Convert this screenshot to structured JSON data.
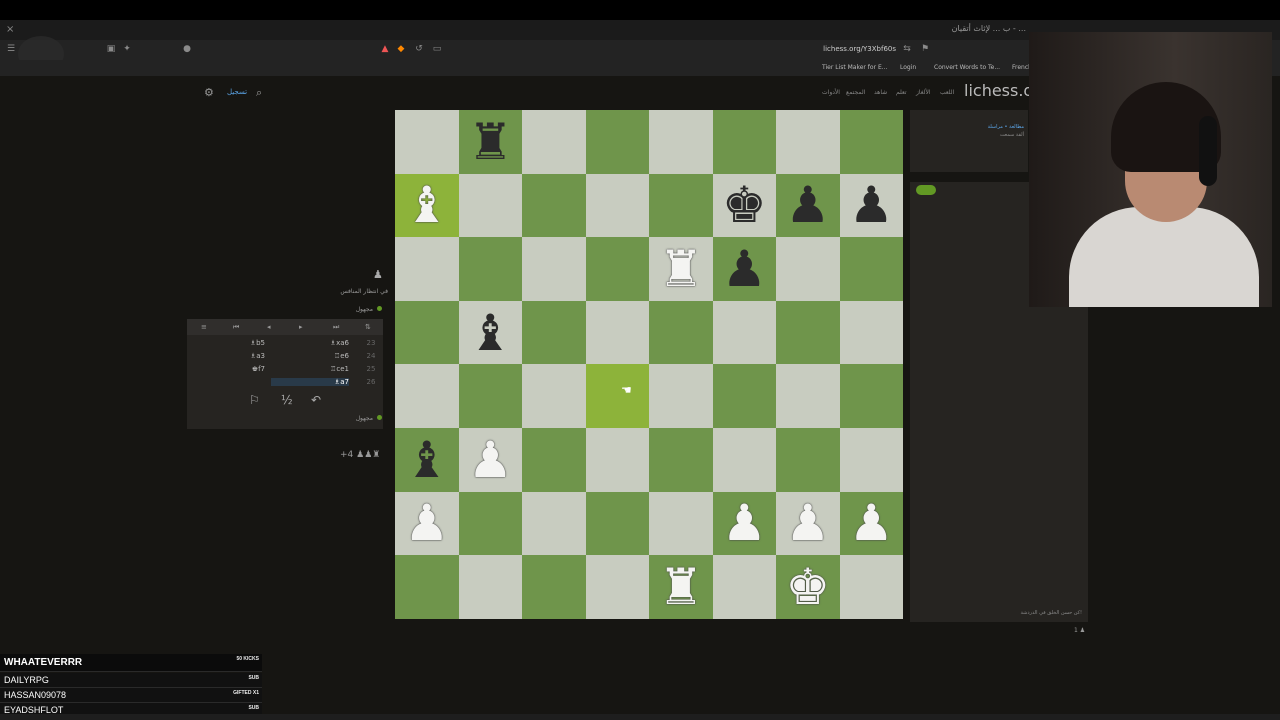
{
  "browser": {
    "tab_close": "×",
    "tab_title_right": "ب ... لإثاث أتقيان - ...",
    "url": "lichess.org/Y3Xbf60s",
    "bookmarks": [
      "Tier List Maker for E...",
      "Login",
      "Convert Words to Te...",
      "French"
    ]
  },
  "site": {
    "logo": "lichess.or",
    "nav": [
      "اللعب",
      "الألغاز",
      "تعلم",
      "شاهد",
      "المجتمع",
      "الأدوات"
    ],
    "signin": "تسجيل"
  },
  "board": {
    "ranks": [
      [
        "",
        "bR",
        "",
        "",
        "",
        "",
        "",
        ""
      ],
      [
        "wB",
        "",
        "",
        "",
        "",
        "bK",
        "bP",
        "bP"
      ],
      [
        "",
        "",
        "",
        "",
        "wR",
        "bP",
        "",
        ""
      ],
      [
        "",
        "bB",
        "",
        "",
        "",
        "",
        "",
        ""
      ],
      [
        "",
        "",
        "",
        "",
        "",
        "",
        "",
        ""
      ],
      [
        "bB",
        "wP",
        "",
        "",
        "",
        "",
        "",
        ""
      ],
      [
        "wP",
        "",
        "",
        "",
        "",
        "wP",
        "wP",
        "wP"
      ],
      [
        "",
        "",
        "",
        "",
        "wR",
        "",
        "wK",
        ""
      ]
    ],
    "highlights": [
      [
        1,
        0
      ],
      [
        4,
        3
      ]
    ]
  },
  "left_panel": {
    "waiting_text": "في انتظار المنافس",
    "opponent": "مجهول",
    "player": "مجهول",
    "moves": [
      {
        "num": "23",
        "white": "♗xa6",
        "black": "♗b5"
      },
      {
        "num": "24",
        "white": "♖e6",
        "black": "♗a3"
      },
      {
        "num": "25",
        "white": "♖ce1",
        "black": "♚f7"
      },
      {
        "num": "26",
        "white": "♗a7",
        "black": ""
      }
    ],
    "material": "+4"
  },
  "right_panel": {
    "side_line1": "مطالعة • مراسلة",
    "side_line2": "ألقة سمعت",
    "chat_placeholder": "كن حسن الخلق في الدردشة!",
    "viewers": "1"
  },
  "leaderboard": [
    {
      "name": "WHAATEVERRR",
      "tag": "50 KICKS"
    },
    {
      "name": "DAILYRPG",
      "tag": "SUB"
    },
    {
      "name": "HASSAN09078",
      "tag": "GIFTED X1"
    },
    {
      "name": "EYADSHFLOT",
      "tag": "SUB"
    }
  ]
}
